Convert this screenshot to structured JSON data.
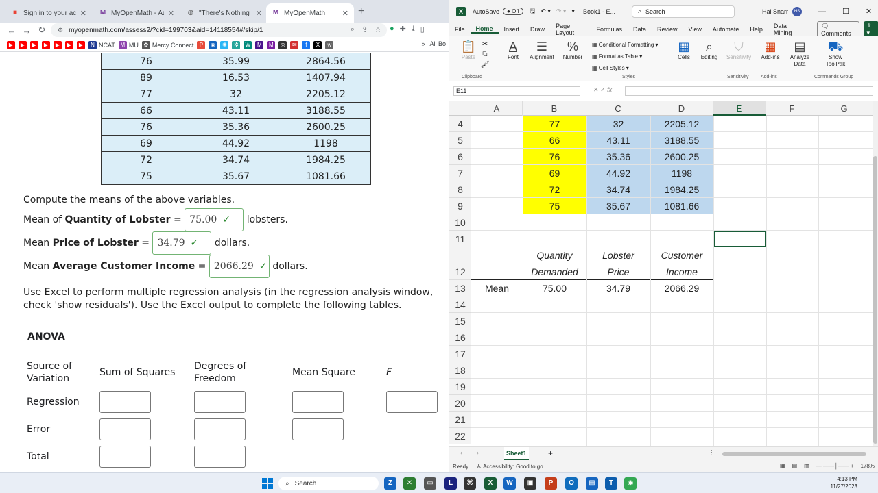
{
  "chrome": {
    "tabs": [
      {
        "title": "Sign in to your account",
        "favicon_color": "#e94235",
        "icon": "microsoft-icon"
      },
      {
        "title": "MyOpenMath - Add/Re",
        "favicon_color": "#7a3f9d",
        "icon": "mom-icon"
      },
      {
        "title": "\"There's Nothing Enco",
        "favicon_color": "#555555",
        "icon": "globe-icon"
      },
      {
        "title": "MyOpenMath",
        "favicon_color": "#7a3f9d",
        "icon": "mom-icon",
        "active": true
      }
    ],
    "url": "myopenmath.com/assess2/?cid=199703&aid=14118554#/skip/1",
    "bookmarks": [
      {
        "label": "",
        "color": "#ff0000"
      },
      {
        "label": "",
        "color": "#ff0000"
      },
      {
        "label": "",
        "color": "#ff0000"
      },
      {
        "label": "",
        "color": "#ff0000"
      },
      {
        "label": "",
        "color": "#ff0000"
      },
      {
        "label": "",
        "color": "#ff0000"
      },
      {
        "label": "NCAT",
        "color": "#1f3a93"
      },
      {
        "label": "MU",
        "color": "#8e44ad"
      },
      {
        "label": "Mercy Connect",
        "color": "#555555"
      }
    ],
    "bookmarks_right": "All Bo"
  },
  "problem": {
    "table_rows": [
      [
        "76",
        "35.99",
        "2864.56"
      ],
      [
        "89",
        "16.53",
        "1407.94"
      ],
      [
        "77",
        "32",
        "2205.12"
      ],
      [
        "66",
        "43.11",
        "3188.55"
      ],
      [
        "76",
        "35.36",
        "2600.25"
      ],
      [
        "69",
        "44.92",
        "1198"
      ],
      [
        "72",
        "34.74",
        "1984.25"
      ],
      [
        "75",
        "35.67",
        "1081.66"
      ]
    ],
    "intro": "Compute the means of the above variables.",
    "mean_qty": {
      "prefix": "Mean of ",
      "bold": "Quantity of Lobster",
      "eq": " = ",
      "value": "75.00",
      "suffix": "lobsters."
    },
    "mean_price": {
      "prefix": "Mean ",
      "bold": "Price of Lobster",
      "eq": " = ",
      "value": "34.79",
      "suffix": "dollars."
    },
    "mean_income": {
      "prefix": "Mean ",
      "bold": "Average Customer Income",
      "eq": " = ",
      "value": "2066.29",
      "suffix": "dollars."
    },
    "instructions_1": "Use Excel to perform multiple regression analysis (in the regression analysis window,",
    "instructions_2": "check 'show residuals'). Use the Excel output to complete the following tables.",
    "anova_title": "ANOVA",
    "anova_headers": [
      "Source of Variation",
      "Sum of Squares",
      "Degrees of Freedom",
      "Mean Square",
      "F"
    ],
    "anova_rows": [
      "Regression",
      "Error",
      "Total"
    ],
    "check_mark": "✓"
  },
  "excel": {
    "autosave_label": "AutoSave",
    "autosave_state": "Off",
    "filename": "Book1 - E...",
    "search_placeholder": "Search",
    "user": "Hal Snarr",
    "user_initials": "HS",
    "menu": [
      "File",
      "Home",
      "Insert",
      "Draw",
      "Page Layout",
      "Formulas",
      "Data",
      "Review",
      "View",
      "Automate",
      "Help",
      "Data Mining"
    ],
    "comments_label": "Comments",
    "ribbon": {
      "paste": "Paste",
      "clipboard": "Clipboard",
      "font": "Font",
      "alignment": "Alignment",
      "number": "Number",
      "conditional_formatting": "Conditional Formatting",
      "format_as_table": "Format as Table",
      "cell_styles": "Cell Styles",
      "styles": "Styles",
      "cells": "Cells",
      "editing": "Editing",
      "sensitivity": "Sensitivity",
      "addins": "Add-ins",
      "analyze_data": "Analyze Data",
      "show_toolpak": "Show ToolPak",
      "commands_group": "Commands Group"
    },
    "name_box": "E11",
    "fx": "fx",
    "columns": [
      "A",
      "B",
      "C",
      "D",
      "E",
      "F",
      "G"
    ],
    "data_rows": [
      {
        "row": "4",
        "B": "77",
        "C": "32",
        "D": "2205.12"
      },
      {
        "row": "5",
        "B": "66",
        "C": "43.11",
        "D": "3188.55"
      },
      {
        "row": "6",
        "B": "76",
        "C": "35.36",
        "D": "2600.25"
      },
      {
        "row": "7",
        "B": "69",
        "C": "44.92",
        "D": "1198"
      },
      {
        "row": "8",
        "B": "72",
        "C": "34.74",
        "D": "1984.25"
      },
      {
        "row": "9",
        "B": "75",
        "C": "35.67",
        "D": "1081.66"
      }
    ],
    "empty_rows": [
      "10",
      "11"
    ],
    "header_row": "12",
    "header_b": [
      "Quantity",
      "Demanded"
    ],
    "header_c": [
      "Lobster",
      "Price"
    ],
    "header_d": [
      "Customer",
      "Income"
    ],
    "mean_row": {
      "row": "13",
      "A": "Mean",
      "B": "75.00",
      "C": "34.79",
      "D": "2066.29"
    },
    "later_rows": [
      "14",
      "15",
      "16",
      "17",
      "18",
      "19",
      "20",
      "21",
      "22"
    ],
    "sheet_name": "Sheet1",
    "status_ready": "Ready",
    "status_accessibility": "Accessibility: Good to go",
    "zoom": "178%",
    "colors": {
      "yellow": "#ffff00",
      "blue": "#bdd7ee",
      "accent": "#185c37"
    }
  },
  "taskbar": {
    "search": "Search",
    "time": "4:13 PM",
    "date": "11/27/2023"
  }
}
